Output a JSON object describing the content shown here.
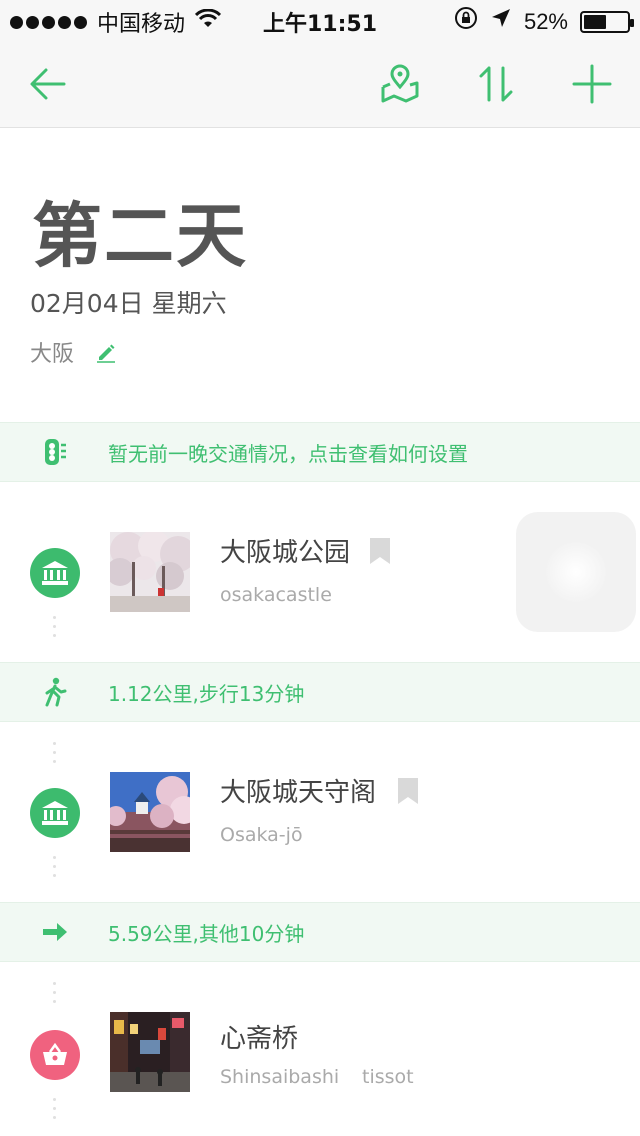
{
  "status_bar": {
    "carrier": "中国移动",
    "time": "上午11:51",
    "battery": "52%",
    "battery_level": 0.52
  },
  "nav": {
    "icons": [
      "back-arrow-icon",
      "map-icon",
      "sort-icon",
      "add-icon"
    ],
    "accent": "#3fbf71"
  },
  "header": {
    "title": "第二天",
    "date": "02月04日 星期六",
    "city": "大阪"
  },
  "transit_tip": "暂无前一晚交通情况，点击查看如何设置",
  "items": [
    {
      "name": "大阪城公园",
      "subtitle": "osakacastle",
      "category": "landmark-icon",
      "color": "#3dbb6e"
    },
    {
      "name": "大阪城天守阁",
      "subtitle": "Osaka-jō",
      "category": "landmark-icon",
      "color": "#3dbb6e"
    },
    {
      "name": "心斋桥",
      "subtitle": "Shinsaibashi",
      "subtitle2": "tissot",
      "category": "shopping-icon",
      "color": "#f0627f"
    }
  ],
  "routes": [
    {
      "text": "1.12公里,步行13分钟",
      "icon": "walk-icon"
    },
    {
      "text": "5.59公里,其他10分钟",
      "icon": "arrow-right-icon"
    }
  ]
}
